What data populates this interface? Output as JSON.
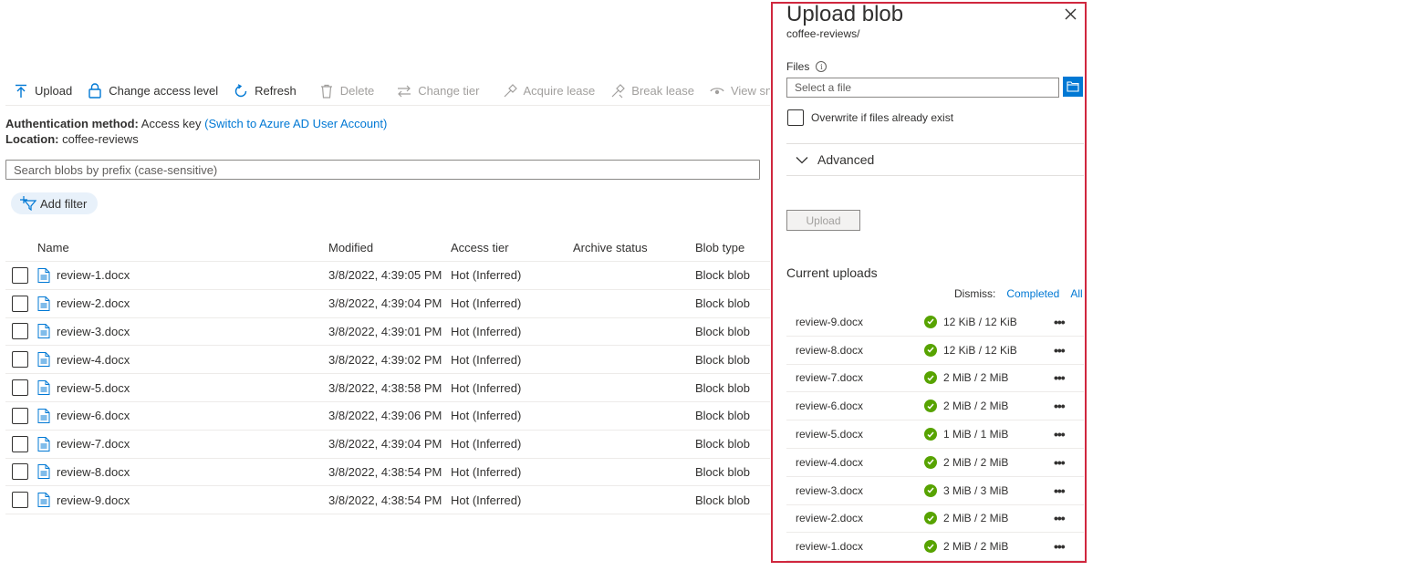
{
  "toolbar": {
    "upload": "Upload",
    "change_access": "Change access level",
    "refresh": "Refresh",
    "delete": "Delete",
    "change_tier": "Change tier",
    "acquire_lease": "Acquire lease",
    "break_lease": "Break lease",
    "view_snapshots": "View snapshots"
  },
  "meta": {
    "auth_label": "Authentication method:",
    "auth_value": "Access key",
    "auth_link": "(Switch to Azure AD User Account)",
    "location_label": "Location:",
    "location_value": "coffee-reviews"
  },
  "search": {
    "placeholder": "Search blobs by prefix (case-sensitive)"
  },
  "filter": {
    "label": "Add filter"
  },
  "grid": {
    "columns": [
      "Name",
      "Modified",
      "Access tier",
      "Archive status",
      "Blob type"
    ],
    "rows": [
      {
        "name": "review-1.docx",
        "modified": "3/8/2022, 4:39:05 PM",
        "tier": "Hot (Inferred)",
        "archive": "",
        "type": "Block blob"
      },
      {
        "name": "review-2.docx",
        "modified": "3/8/2022, 4:39:04 PM",
        "tier": "Hot (Inferred)",
        "archive": "",
        "type": "Block blob"
      },
      {
        "name": "review-3.docx",
        "modified": "3/8/2022, 4:39:01 PM",
        "tier": "Hot (Inferred)",
        "archive": "",
        "type": "Block blob"
      },
      {
        "name": "review-4.docx",
        "modified": "3/8/2022, 4:39:02 PM",
        "tier": "Hot (Inferred)",
        "archive": "",
        "type": "Block blob"
      },
      {
        "name": "review-5.docx",
        "modified": "3/8/2022, 4:38:58 PM",
        "tier": "Hot (Inferred)",
        "archive": "",
        "type": "Block blob"
      },
      {
        "name": "review-6.docx",
        "modified": "3/8/2022, 4:39:06 PM",
        "tier": "Hot (Inferred)",
        "archive": "",
        "type": "Block blob"
      },
      {
        "name": "review-7.docx",
        "modified": "3/8/2022, 4:39:04 PM",
        "tier": "Hot (Inferred)",
        "archive": "",
        "type": "Block blob"
      },
      {
        "name": "review-8.docx",
        "modified": "3/8/2022, 4:38:54 PM",
        "tier": "Hot (Inferred)",
        "archive": "",
        "type": "Block blob"
      },
      {
        "name": "review-9.docx",
        "modified": "3/8/2022, 4:38:54 PM",
        "tier": "Hot (Inferred)",
        "archive": "",
        "type": "Block blob"
      }
    ]
  },
  "panel": {
    "title": "Upload blob",
    "subtitle": "coffee-reviews/",
    "files_label": "Files",
    "file_placeholder": "Select a file",
    "overwrite_label": "Overwrite if files already exist",
    "advanced_label": "Advanced",
    "upload_button": "Upload",
    "current_uploads": "Current uploads",
    "dismiss_label": "Dismiss:",
    "dismiss_completed": "Completed",
    "dismiss_all": "All",
    "uploads": [
      {
        "name": "review-9.docx",
        "size": "12 KiB / 12 KiB"
      },
      {
        "name": "review-8.docx",
        "size": "12 KiB / 12 KiB"
      },
      {
        "name": "review-7.docx",
        "size": "2 MiB / 2 MiB"
      },
      {
        "name": "review-6.docx",
        "size": "2 MiB / 2 MiB"
      },
      {
        "name": "review-5.docx",
        "size": "1 MiB / 1 MiB"
      },
      {
        "name": "review-4.docx",
        "size": "2 MiB / 2 MiB"
      },
      {
        "name": "review-3.docx",
        "size": "3 MiB / 3 MiB"
      },
      {
        "name": "review-2.docx",
        "size": "2 MiB / 2 MiB"
      },
      {
        "name": "review-1.docx",
        "size": "2 MiB / 2 MiB"
      }
    ]
  },
  "colors": {
    "accent": "#0078d4",
    "success": "#57a300",
    "highlight_border": "#d0273e"
  }
}
